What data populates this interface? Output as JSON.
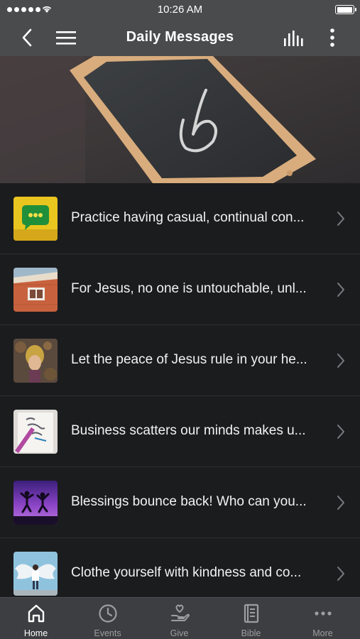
{
  "status_bar": {
    "time": "10:26 AM",
    "battery_level": 1.0
  },
  "nav": {
    "title": "Daily Messages",
    "icons": [
      "chevron-left-icon",
      "hamburger-menu-icon",
      "bar-chart-icon",
      "vertical-dots-icon"
    ]
  },
  "hero": {
    "image": "tablet-with-chalk-checkmark"
  },
  "list": {
    "items": [
      {
        "title": "Practice having casual, continual con...",
        "thumb": "green-speech-bubble"
      },
      {
        "title": "For Jesus, no one is untouchable, unl...",
        "thumb": "brick-building-window"
      },
      {
        "title": "Let the peace of Jesus rule in your he...",
        "thumb": "girl-lying-in-leaves"
      },
      {
        "title": "Business scatters our minds makes u...",
        "thumb": "notebook-lettering"
      },
      {
        "title": "Blessings bounce back! Who can you...",
        "thumb": "people-jumping-purple-sky"
      },
      {
        "title": "Clothe yourself with kindness and co...",
        "thumb": "person-with-wings-mural"
      }
    ]
  },
  "tabs": [
    {
      "label": "Home",
      "icon": "home-icon",
      "active": true
    },
    {
      "label": "Events",
      "icon": "clock-icon",
      "active": false
    },
    {
      "label": "Give",
      "icon": "hand-heart-icon",
      "active": false
    },
    {
      "label": "Bible",
      "icon": "book-icon",
      "active": false
    },
    {
      "label": "More",
      "icon": "more-dots-icon",
      "active": false
    }
  ],
  "colors": {
    "bar_background": "#4a4b4d",
    "list_background": "#1b1c1e",
    "tab_bar_background": "#3d3e41",
    "tab_inactive": "#9d9ea1",
    "tab_active": "#ffffff"
  }
}
